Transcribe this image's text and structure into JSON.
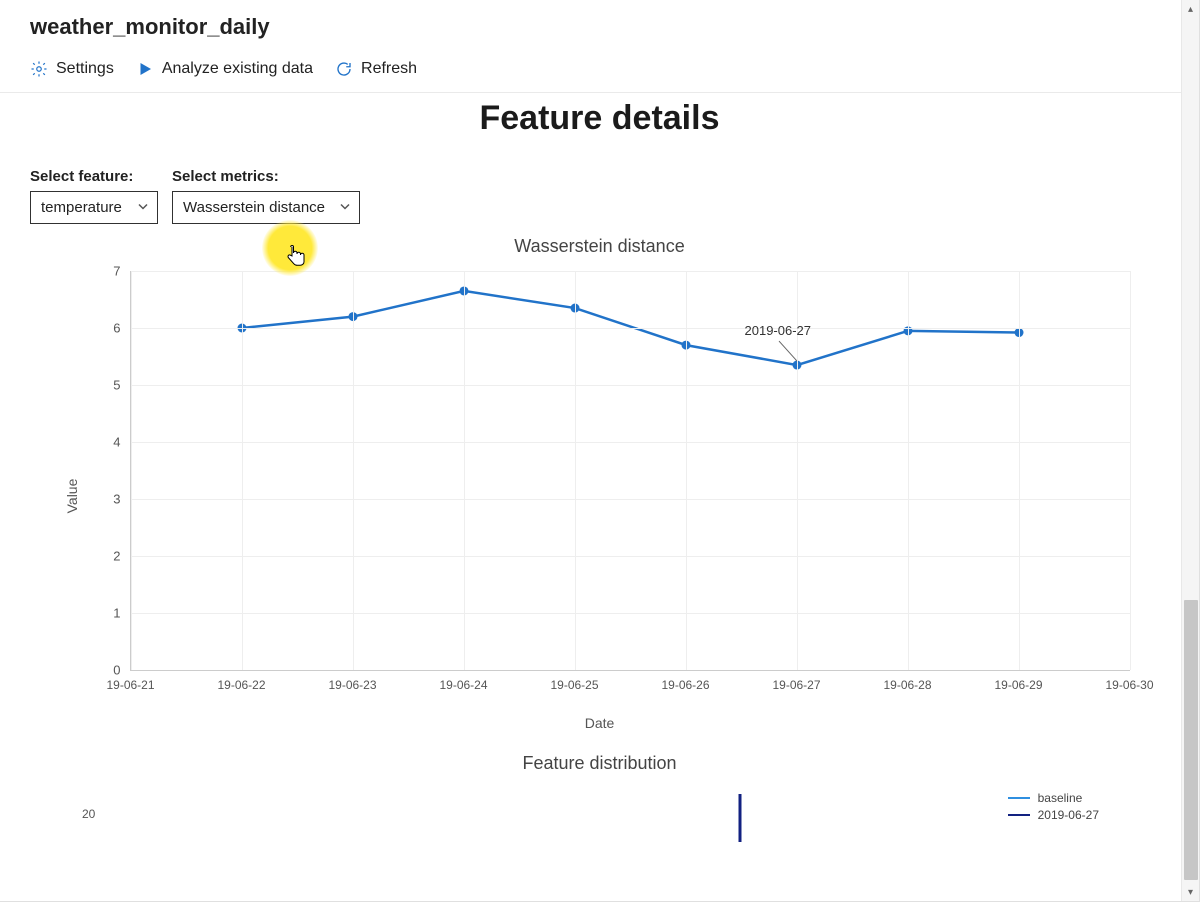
{
  "header": {
    "title": "weather_monitor_daily"
  },
  "toolbar": {
    "settings_label": "Settings",
    "analyze_label": "Analyze existing data",
    "refresh_label": "Refresh"
  },
  "section": {
    "title": "Feature details"
  },
  "filters": {
    "feature_label": "Select feature:",
    "feature_value": "temperature",
    "metrics_label": "Select metrics:",
    "metrics_value": "Wasserstein distance"
  },
  "chart_data": {
    "type": "line",
    "title": "Wasserstein distance",
    "xlabel": "Date",
    "ylabel": "Value",
    "ylim": [
      0,
      7
    ],
    "yticks": [
      0,
      1,
      2,
      3,
      4,
      5,
      6,
      7
    ],
    "categories": [
      "19-06-21",
      "19-06-22",
      "19-06-23",
      "19-06-24",
      "19-06-25",
      "19-06-26",
      "19-06-27",
      "19-06-28",
      "19-06-29",
      "19-06-30"
    ],
    "x": [
      "19-06-22",
      "19-06-23",
      "19-06-24",
      "19-06-25",
      "19-06-26",
      "19-06-27",
      "19-06-28",
      "19-06-29"
    ],
    "values": [
      6.0,
      6.2,
      6.65,
      6.35,
      5.7,
      5.35,
      5.95,
      5.92
    ],
    "annotation": {
      "label": "2019-06-27",
      "x": "19-06-27"
    },
    "color": "#2173c9"
  },
  "chart2": {
    "title": "Feature distribution",
    "ytick": "20",
    "legend": [
      {
        "name": "baseline",
        "color": "#2f8fe0"
      },
      {
        "name": "2019-06-27",
        "color": "#122181"
      }
    ]
  }
}
